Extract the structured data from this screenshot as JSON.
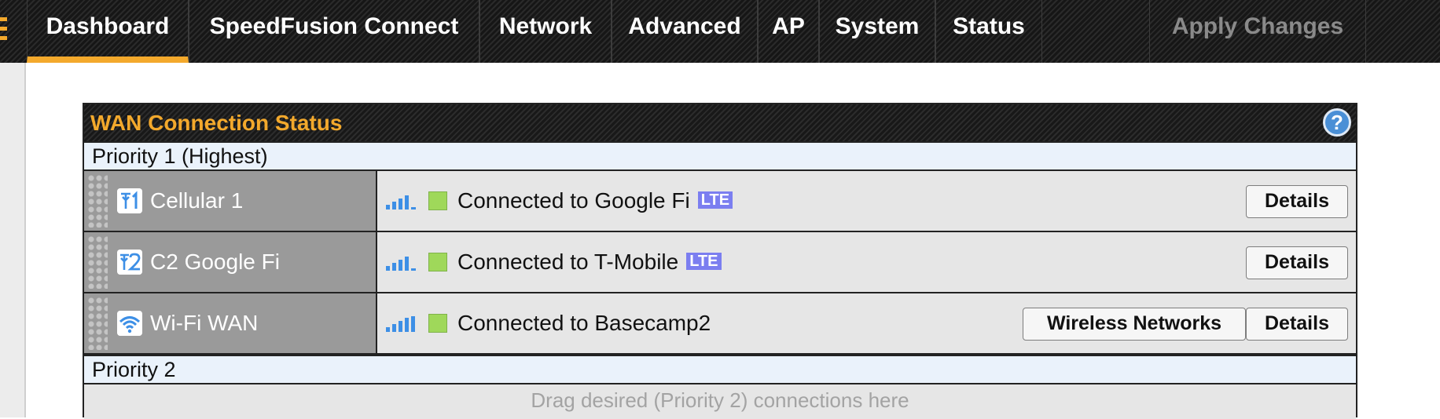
{
  "nav": {
    "items": [
      {
        "label": "Dashboard",
        "active": true
      },
      {
        "label": "SpeedFusion Connect"
      },
      {
        "label": "Network"
      },
      {
        "label": "Advanced"
      },
      {
        "label": "AP"
      },
      {
        "label": "System"
      },
      {
        "label": "Status"
      }
    ],
    "apply_label": "Apply Changes"
  },
  "panel": {
    "title": "WAN Connection Status",
    "help_glyph": "?",
    "priority1_label": "Priority 1 (Highest)",
    "priority2_label": "Priority 2",
    "drop_hint": "Drag desired (Priority 2) connections here",
    "connections": [
      {
        "name": "Cellular 1",
        "icon": "cellular-1-icon",
        "status": "Connected to Google Fi",
        "badge": "LTE",
        "signal_bars": 3,
        "details_label": "Details"
      },
      {
        "name": "C2 Google Fi",
        "icon": "cellular-2-icon",
        "status": "Connected to T-Mobile",
        "badge": "LTE",
        "signal_bars": 3,
        "details_label": "Details"
      },
      {
        "name": "Wi-Fi WAN",
        "icon": "wifi-icon",
        "status": "Connected to Basecamp2",
        "signal_bars": 4,
        "networks_label": "Wireless Networks",
        "details_label": "Details"
      }
    ]
  },
  "colors": {
    "accent": "#f3a92c",
    "led_connected": "#9fd85a",
    "signal": "#3d8fe6",
    "lte_badge": "#7b7ef0"
  }
}
